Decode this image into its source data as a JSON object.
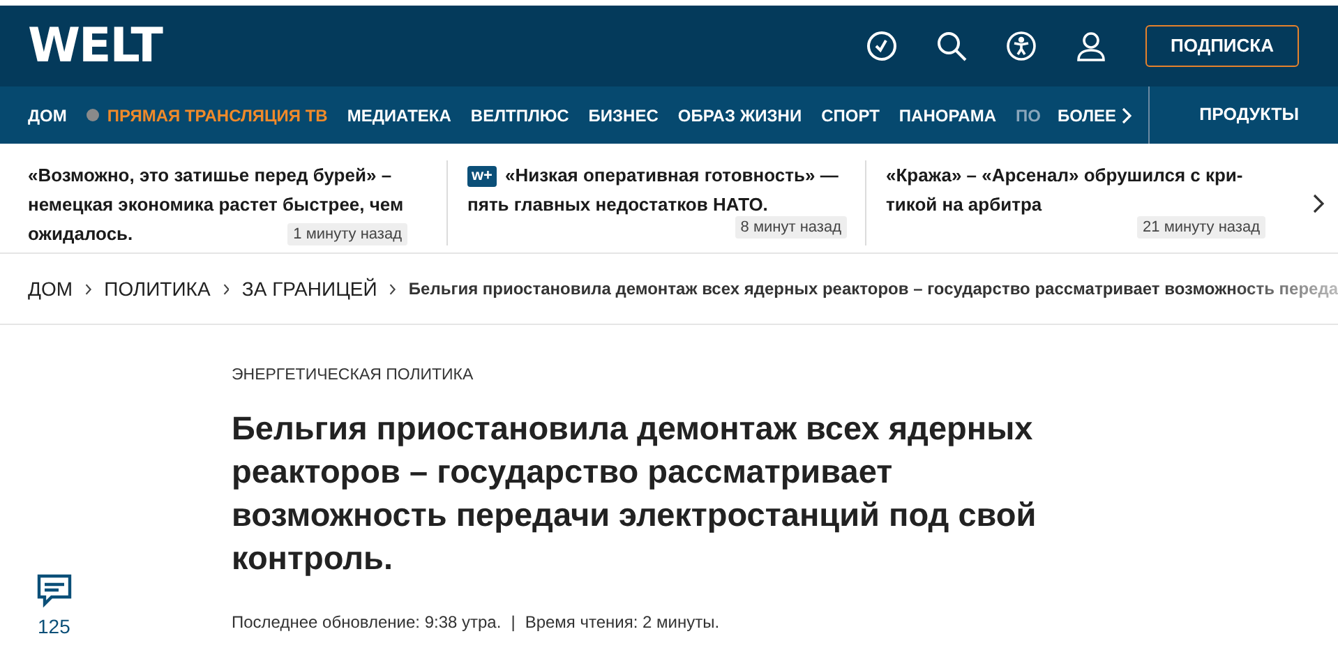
{
  "header": {
    "logo": "WELT",
    "subscribe": "ПОДПИСКА"
  },
  "nav": {
    "items": [
      {
        "label": "ДОМ",
        "kind": "plain"
      },
      {
        "label": "ПРЯМАЯ ТРАНСЛЯЦИЯ ТВ",
        "kind": "live"
      },
      {
        "label": "МЕДИАТЕКА",
        "kind": "plain"
      },
      {
        "label": "ВЕЛТПЛЮС",
        "kind": "plain"
      },
      {
        "label": "БИЗНЕС",
        "kind": "plain"
      },
      {
        "label": "ОБРАЗ ЖИЗНИ",
        "kind": "plain"
      },
      {
        "label": "СПОРТ",
        "kind": "plain"
      },
      {
        "label": "ПАНОРАМА",
        "kind": "plain"
      },
      {
        "label": "ПО",
        "kind": "faded"
      }
    ],
    "more": "БОЛЕЕ",
    "products": "ПРОДУКТЫ"
  },
  "teasers": [
    {
      "text": "«Возможно, это затишье перед бурей» – немецкая экономика растет быстрее, чем ожидалось.",
      "time": "1 минуту назад",
      "premium": false
    },
    {
      "text": "«Низкая оперативная готовность» — пять главных недостатков НАТО.",
      "time": "8 минут назад",
      "premium": true,
      "badge": "w+"
    },
    {
      "text": "«Кража» – «Арсенал» обрушился с кри-тикой на арбитра",
      "time": "21 минуту назад",
      "premium": false
    }
  ],
  "breadcrumbs": {
    "items": [
      "ДОМ",
      "ПОЛИТИКА",
      "ЗА ГРАНИЦЕЙ"
    ],
    "current": "Бельгия приостановила демонтаж всех ядерных реакторов – государство рассматривает возможность переда"
  },
  "article": {
    "kicker": "ЭНЕРГЕТИЧЕСКАЯ ПОЛИТИКА",
    "headline": "Бельгия приостановила демонтаж всех ядерных реакторов – государство рассматривает возможность передачи электростанций под свой контроль.",
    "comments": "125",
    "updated": "Последнее обновление: 9:38 утра.",
    "separator": "|",
    "reading_time": "Время чтения: 2 минуты."
  }
}
